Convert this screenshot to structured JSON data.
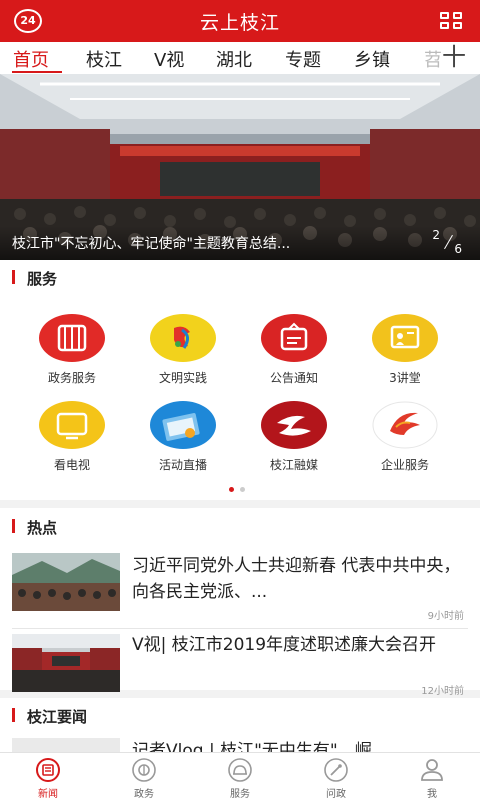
{
  "header": {
    "logo_text": "24",
    "title": "云上枝江",
    "grid_icon": "grid-icon"
  },
  "tabs": [
    {
      "label": "首页",
      "active": true
    },
    {
      "label": "枝江"
    },
    {
      "label": "V视"
    },
    {
      "label": "湖北"
    },
    {
      "label": "专题"
    },
    {
      "label": "乡镇"
    },
    {
      "label": "苕"
    }
  ],
  "tabs_plus": "十",
  "banner": {
    "caption": "枝江市\"不忘初心、牢记使命\"主题教育总结...",
    "current_page": "2",
    "total_pages": "6"
  },
  "services": {
    "title": "服务",
    "items": [
      {
        "label": "政务服务",
        "icon": "government-service-icon",
        "color": "#e12a27"
      },
      {
        "label": "文明实践",
        "icon": "civilization-practice-icon",
        "color": "#f2d21c"
      },
      {
        "label": "公告通知",
        "icon": "notice-icon",
        "color": "#d92424"
      },
      {
        "label": "3讲堂",
        "icon": "lecture-hall-icon",
        "color": "#f2c21c"
      },
      {
        "label": "看电视",
        "icon": "tv-icon",
        "color": "#f4c418"
      },
      {
        "label": "活动直播",
        "icon": "live-stream-icon",
        "color": "#1e88d8"
      },
      {
        "label": "枝江融媒",
        "icon": "zhijiang-media-icon",
        "color": "#b3151b"
      },
      {
        "label": "企业服务",
        "icon": "enterprise-service-icon",
        "color": "#e13a2a"
      }
    ],
    "pager": {
      "active_color": "#d7191a",
      "inactive_color": "#cccccc"
    }
  },
  "hot": {
    "title": "热点",
    "items": [
      {
        "title": "习近平同党外人士共迎新春 代表中共中央，向各民主党派、...",
        "time": "9小时前"
      },
      {
        "title": "V视| 枝江市2019年度述职述廉大会召开",
        "time": "12小时前"
      }
    ]
  },
  "local_news": {
    "title": "枝江要闻",
    "items": [
      {
        "title": "记者Vlog | 枝江\"无中生有\"，崛"
      }
    ]
  },
  "bottom_nav": [
    {
      "label": "新闻",
      "icon": "news-icon",
      "active": true
    },
    {
      "label": "政务",
      "icon": "government-icon"
    },
    {
      "label": "服务",
      "icon": "service-icon"
    },
    {
      "label": "问政",
      "icon": "inquiry-icon"
    },
    {
      "label": "我",
      "icon": "profile-icon"
    }
  ],
  "colors": {
    "accent": "#d7191a"
  }
}
